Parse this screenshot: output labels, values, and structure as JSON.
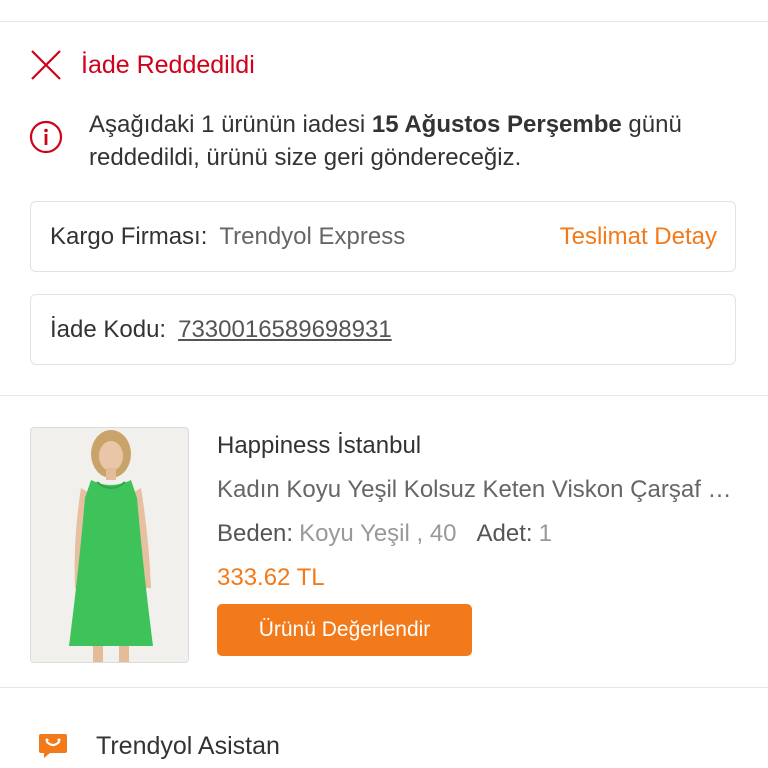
{
  "status": {
    "title": "İade Reddedildi",
    "icon": "close-icon",
    "color": "#d0021b"
  },
  "info": {
    "icon": "info-icon",
    "text_before": "Aşağıdaki 1 ürünün iadesi ",
    "text_bold": "15 Ağustos Perşembe",
    "text_after": " günü reddedildi, ürünü size geri göndereceğiz."
  },
  "cargo": {
    "label": "Kargo Firması:",
    "value": "Trendyol Express",
    "link": "Teslimat Detay"
  },
  "return_code": {
    "label": "İade Kodu:",
    "value": "7330016589698931"
  },
  "product": {
    "brand": "Happiness İstanbul",
    "name": "Kadın Koyu Yeşil Kolsuz Keten Viskon Çarşaf Elbise",
    "size_label": "Beden:",
    "size_value": "Koyu Yeşil , 40",
    "qty_label": "Adet:",
    "qty_value": "1",
    "price": "333.62 TL",
    "rate_button": "Ürünü Değerlendir"
  },
  "assistant": {
    "label": "Trendyol Asistan",
    "icon": "chat-assistant-icon"
  },
  "colors": {
    "accent": "#f27a1a",
    "error": "#d0021b",
    "dress": "#3ec25a"
  }
}
